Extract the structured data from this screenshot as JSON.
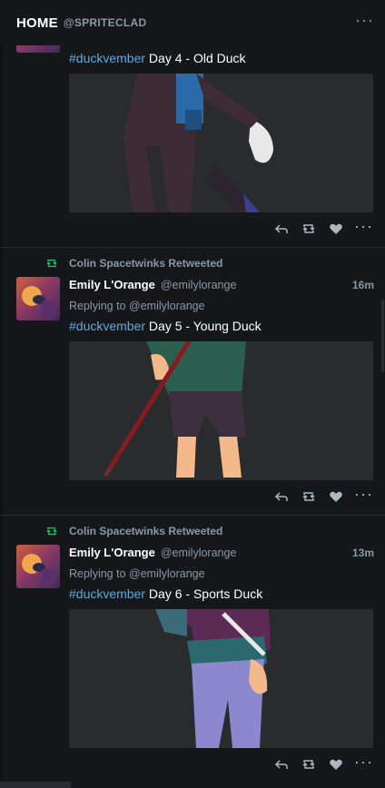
{
  "header": {
    "title": "HOME",
    "handle": "@SPRITECLAD",
    "menu": "···"
  },
  "tweets": [
    {
      "text_hashtag": "#duckvember",
      "text_rest": " Day 4 - Old Duck"
    },
    {
      "retweet_label": "Colin Spacetwinks Retweeted",
      "name": "Emily L'Orange",
      "username": "@emilylorange",
      "time": "16m",
      "reply_to": "Replying to @emilylorange",
      "text_hashtag": "#duckvember",
      "text_rest": " Day 5 - Young Duck"
    },
    {
      "retweet_label": "Colin Spacetwinks Retweeted",
      "name": "Emily L'Orange",
      "username": "@emilylorange",
      "time": "13m",
      "reply_to": "Replying to @emilylorange",
      "text_hashtag": "#duckvember",
      "text_rest": " Day 6 - Sports Duck"
    }
  ],
  "actions": {
    "more": "···"
  },
  "colors": {
    "background": "#15171b",
    "hashtag": "#5fa8e0",
    "retweet_green": "#17bf63",
    "muted": "#8899a6"
  },
  "icons": [
    "reply-icon",
    "retweet-icon",
    "like-icon",
    "more-icon"
  ]
}
